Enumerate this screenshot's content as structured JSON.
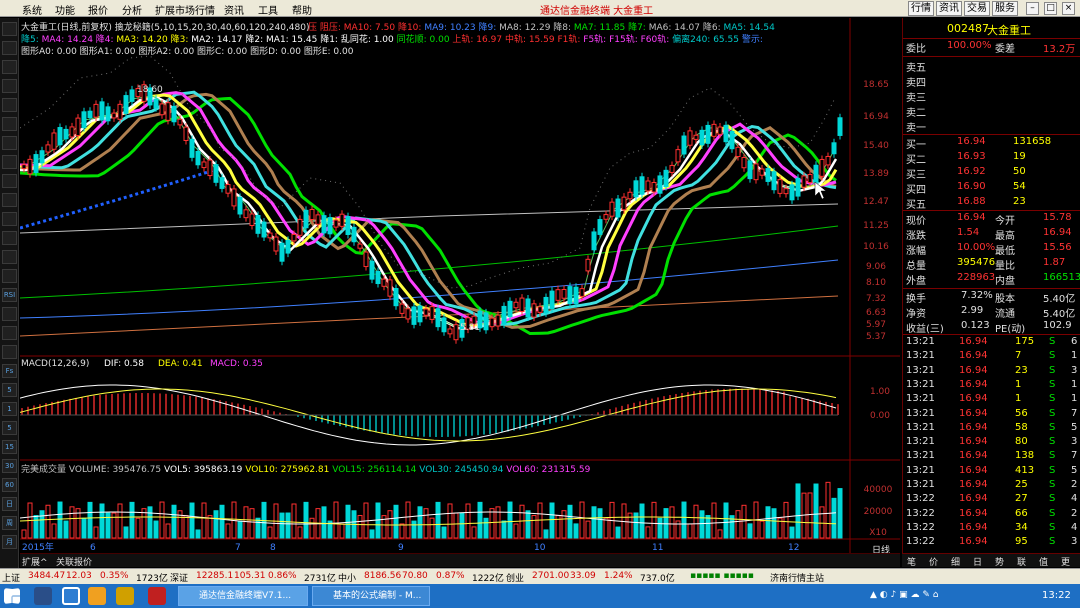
{
  "menu": {
    "items": [
      "系统",
      "功能",
      "报价",
      "分析",
      "扩展市场行情",
      "资讯",
      "工具",
      "帮助"
    ],
    "app_title": "通达信金融终端   大金重工",
    "right_tabs": [
      "行情",
      "资讯",
      "交易",
      "服务"
    ]
  },
  "chart": {
    "title_line": "大金重工(日线,前复权) 擒龙秘籍(5,10,15,20,30,40,60,120,240,480)",
    "line1": [
      {
        "t": "压",
        "c": "#ff3030"
      },
      {
        "t": "阻压:",
        "c": "#ff3030"
      },
      {
        "t": "MA10: 7.50",
        "c": "#ff3030"
      },
      {
        "t": "降10:",
        "c": "#ff3030"
      },
      {
        "t": "MA9: 10.23",
        "c": "#4080ff"
      },
      {
        "t": "降9:",
        "c": "#4080ff"
      },
      {
        "t": "MA8: 12.29",
        "c": "#c0c0c0"
      },
      {
        "t": "降8:",
        "c": "#c0c0c0"
      },
      {
        "t": "MA7: 11.85",
        "c": "#00e000"
      },
      {
        "t": "降7:",
        "c": "#00e000"
      },
      {
        "t": "MA6: 14.07",
        "c": "#c0c0c0"
      },
      {
        "t": "降6:",
        "c": "#c0c0c0"
      },
      {
        "t": "MA5: 14.54",
        "c": "#00c8c8"
      }
    ],
    "line2": [
      {
        "t": "降5:",
        "c": "#00c8c8"
      },
      {
        "t": "MA4: 14.24",
        "c": "#ff40ff"
      },
      {
        "t": "降4:",
        "c": "#ff40ff"
      },
      {
        "t": "MA3: 14.20",
        "c": "#ffff00"
      },
      {
        "t": "降3:",
        "c": "#ffff00"
      },
      {
        "t": "MA2: 14.17",
        "c": "#ffffff"
      },
      {
        "t": "降2:",
        "c": "#ffffff"
      },
      {
        "t": "MA1: 15.45",
        "c": "#ffffff"
      },
      {
        "t": "降1:",
        "c": "#ffffff"
      },
      {
        "t": "乱同花: 1.00",
        "c": "#ffffff"
      },
      {
        "t": "同花顺: 0.00",
        "c": "#00e000"
      },
      {
        "t": "上轨: 16.97",
        "c": "#ff3030"
      },
      {
        "t": "中轨: 15.59",
        "c": "#ff3030"
      },
      {
        "t": "F1轨:",
        "c": "#ff3030"
      },
      {
        "t": "F5轨:",
        "c": "#ff40ff"
      },
      {
        "t": "F15轨:",
        "c": "#ff40ff"
      },
      {
        "t": "F60轨:",
        "c": "#ff40ff"
      },
      {
        "t": "偏离240: 65.55",
        "c": "#00c8c8"
      },
      {
        "t": "警示:",
        "c": "#4080ff"
      }
    ],
    "line3": "图形A0: 0.00  图形A1: 0.00  图形A2: 0.00  图形C: 0.00  图形D: 0.00  图形E: 0.00",
    "price_labels": [
      "18.65",
      "16.94",
      "15.40",
      "13.89",
      "12.47",
      "11.25",
      "10.16",
      "9.06",
      "8.10",
      "7.32",
      "6.63",
      "5.97",
      "5.37"
    ],
    "annot_high": "18.60",
    "annot_low": "5.81",
    "macd_title": "MACD(12,26,9)",
    "macd_dif": "DIF: 0.58",
    "macd_dea": "DEA: 0.41",
    "macd_macd": "MACD: 0.35",
    "macd_axis": [
      "1.00",
      "0.00"
    ],
    "vol_line": [
      {
        "t": "完美成交量",
        "c": "#c0c0c0"
      },
      {
        "t": "VOLUME: 395476.75",
        "c": "#c0c0c0"
      },
      {
        "t": "VOL5: 395863.19",
        "c": "#ffffff"
      },
      {
        "t": "VOL10: 275962.81",
        "c": "#ffff00"
      },
      {
        "t": "VOL15: 256114.14",
        "c": "#00e000"
      },
      {
        "t": "VOL30: 245450.94",
        "c": "#00c8c8"
      },
      {
        "t": "VOL60: 231315.59",
        "c": "#ff40ff"
      }
    ],
    "vol_axis": [
      "40000",
      "20000",
      "X10"
    ],
    "dates": [
      "2015年",
      "6",
      "7",
      "8",
      "9",
      "10",
      "11",
      "12"
    ],
    "period": "日线",
    "bottom_tabs": [
      "扩展^",
      "关联报价"
    ]
  },
  "left_toolbar": [
    "",
    "",
    "",
    "",
    "",
    "",
    "",
    "",
    "",
    "",
    "",
    "",
    "",
    "",
    "RSI",
    "",
    "",
    "",
    "Fs",
    "5",
    "1",
    "5",
    "15",
    "30",
    "60",
    "日",
    "周",
    "月"
  ],
  "right_panel": {
    "code": "002487",
    "name": "大金重工",
    "weibi_label": "委比",
    "weibi": "100.00%",
    "weicha_label": "委差",
    "weicha": "13.2万",
    "asks": [
      {
        "label": "卖五",
        "price": "",
        "vol": ""
      },
      {
        "label": "卖四",
        "price": "",
        "vol": ""
      },
      {
        "label": "卖三",
        "price": "",
        "vol": ""
      },
      {
        "label": "卖二",
        "price": "",
        "vol": ""
      },
      {
        "label": "卖一",
        "price": "",
        "vol": ""
      }
    ],
    "bids": [
      {
        "label": "买一",
        "price": "16.94",
        "vol": "131658"
      },
      {
        "label": "买二",
        "price": "16.93",
        "vol": "19"
      },
      {
        "label": "买三",
        "price": "16.92",
        "vol": "50"
      },
      {
        "label": "买四",
        "price": "16.90",
        "vol": "54"
      },
      {
        "label": "买五",
        "price": "16.88",
        "vol": "23"
      }
    ],
    "stats": [
      {
        "l1": "现价",
        "v1": "16.94",
        "c1": "red",
        "l2": "今开",
        "v2": "15.78",
        "c2": "red"
      },
      {
        "l1": "涨跌",
        "v1": "1.54",
        "c1": "red",
        "l2": "最高",
        "v2": "16.94",
        "c2": "red"
      },
      {
        "l1": "涨幅",
        "v1": "10.00%",
        "c1": "red",
        "l2": "最低",
        "v2": "15.56",
        "c2": "red"
      },
      {
        "l1": "总量",
        "v1": "395476",
        "c1": "yel",
        "l2": "量比",
        "v2": "1.87",
        "c2": "red"
      },
      {
        "l1": "外盘",
        "v1": "228963",
        "c1": "red",
        "l2": "内盘",
        "v2": "166513",
        "c2": "grn"
      }
    ],
    "stats2": [
      {
        "l1": "换手",
        "v1": "7.32%",
        "l2": "股本",
        "v2": "5.40亿"
      },
      {
        "l1": "净资",
        "v1": "2.99",
        "l2": "流通",
        "v2": "5.40亿"
      },
      {
        "l1": "收益(三)",
        "v1": "0.123",
        "l2": "PE(动)",
        "v2": "102.9"
      }
    ],
    "ticks": [
      {
        "time": "13:21",
        "price": "16.94",
        "vol": "175",
        "side": "S",
        "n": "6"
      },
      {
        "time": "13:21",
        "price": "16.94",
        "vol": "7",
        "side": "S",
        "n": "1"
      },
      {
        "time": "13:21",
        "price": "16.94",
        "vol": "23",
        "side": "S",
        "n": "3"
      },
      {
        "time": "13:21",
        "price": "16.94",
        "vol": "1",
        "side": "S",
        "n": "1"
      },
      {
        "time": "13:21",
        "price": "16.94",
        "vol": "1",
        "side": "S",
        "n": "1"
      },
      {
        "time": "13:21",
        "price": "16.94",
        "vol": "56",
        "side": "S",
        "n": "7"
      },
      {
        "time": "13:21",
        "price": "16.94",
        "vol": "58",
        "side": "S",
        "n": "5"
      },
      {
        "time": "13:21",
        "price": "16.94",
        "vol": "80",
        "side": "S",
        "n": "3"
      },
      {
        "time": "13:21",
        "price": "16.94",
        "vol": "138",
        "side": "S",
        "n": "7"
      },
      {
        "time": "13:21",
        "price": "16.94",
        "vol": "413",
        "side": "S",
        "n": "5"
      },
      {
        "time": "13:21",
        "price": "16.94",
        "vol": "25",
        "side": "S",
        "n": "2"
      },
      {
        "time": "13:22",
        "price": "16.94",
        "vol": "27",
        "side": "S",
        "n": "4"
      },
      {
        "time": "13:22",
        "price": "16.94",
        "vol": "66",
        "side": "S",
        "n": "2"
      },
      {
        "time": "13:22",
        "price": "16.94",
        "vol": "34",
        "side": "S",
        "n": "4"
      },
      {
        "time": "13:22",
        "price": "16.94",
        "vol": "95",
        "side": "S",
        "n": "3"
      }
    ],
    "tabs": [
      "笔",
      "价",
      "细",
      "日",
      "势",
      "联",
      "值",
      "更"
    ]
  },
  "status": {
    "items": [
      {
        "name": "上证",
        "val": "3484.47",
        "chg": "12.03",
        "pct": "0.35%",
        "amt": "1723亿"
      },
      {
        "name": "深证",
        "val": "12285.1",
        "chg": "105.31",
        "pct": "0.86%",
        "amt": "2731亿"
      },
      {
        "name": "中小",
        "val": "8186.56",
        "chg": "70.80",
        "pct": "0.87%",
        "amt": "1222亿"
      },
      {
        "name": "创业",
        "val": "2701.00",
        "chg": "33.09",
        "pct": "1.24%",
        "amt": "737.0亿"
      }
    ],
    "server": "济南行情主站"
  },
  "taskbar": {
    "tasks": [
      "通达信金融终端V7.1...",
      "基本的公式编制 - M..."
    ],
    "clock": "13:22"
  }
}
